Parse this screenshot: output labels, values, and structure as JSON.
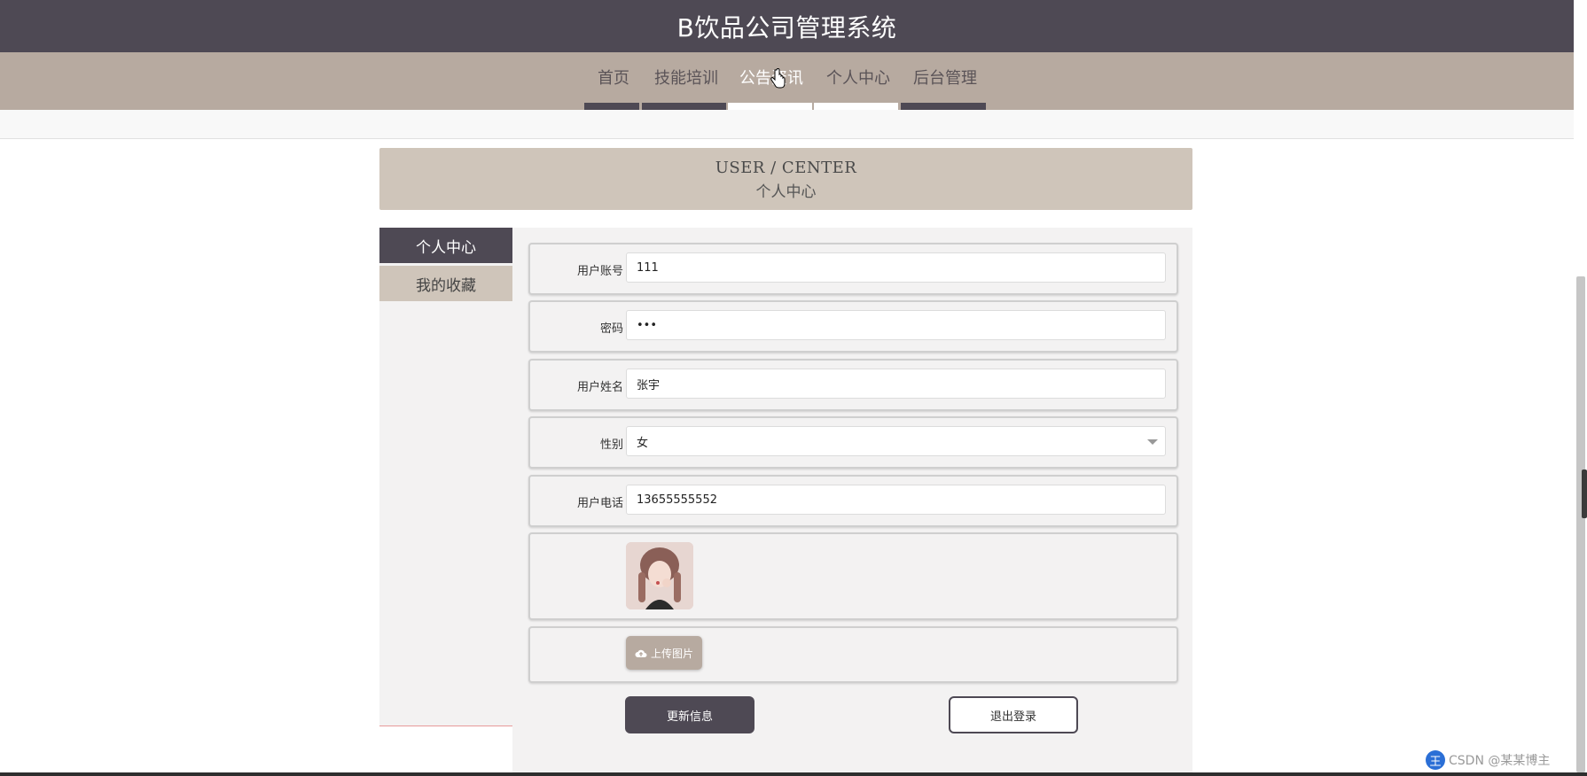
{
  "app": {
    "title": "B饮品公司管理系统"
  },
  "nav": {
    "items": [
      {
        "label": "首页"
      },
      {
        "label": "技能培训"
      },
      {
        "label": "公告资讯"
      },
      {
        "label": "个人中心"
      },
      {
        "label": "后台管理"
      }
    ],
    "active_index": 2
  },
  "banner": {
    "en": "USER / CENTER",
    "zh": "个人中心"
  },
  "sidebar": {
    "items": [
      {
        "label": "个人中心",
        "active": true
      },
      {
        "label": "我的收藏",
        "active": false
      }
    ]
  },
  "form": {
    "account": {
      "label": "用户账号",
      "value": "111"
    },
    "password": {
      "label": "密码",
      "value": "•••"
    },
    "name": {
      "label": "用户姓名",
      "value": "张宇"
    },
    "gender": {
      "label": "性别",
      "value": "女"
    },
    "phone": {
      "label": "用户电话",
      "value": "13655555552"
    },
    "upload_label": "上传图片",
    "update_button": "更新信息",
    "logout_button": "退出登录"
  },
  "watermark": {
    "badge": "王",
    "text": "CSDN @某某博主"
  },
  "colors": {
    "header": "#4e4954",
    "nav": "#b7aaa0",
    "banner": "#cfc5ba",
    "panel": "#f3f2f2"
  }
}
